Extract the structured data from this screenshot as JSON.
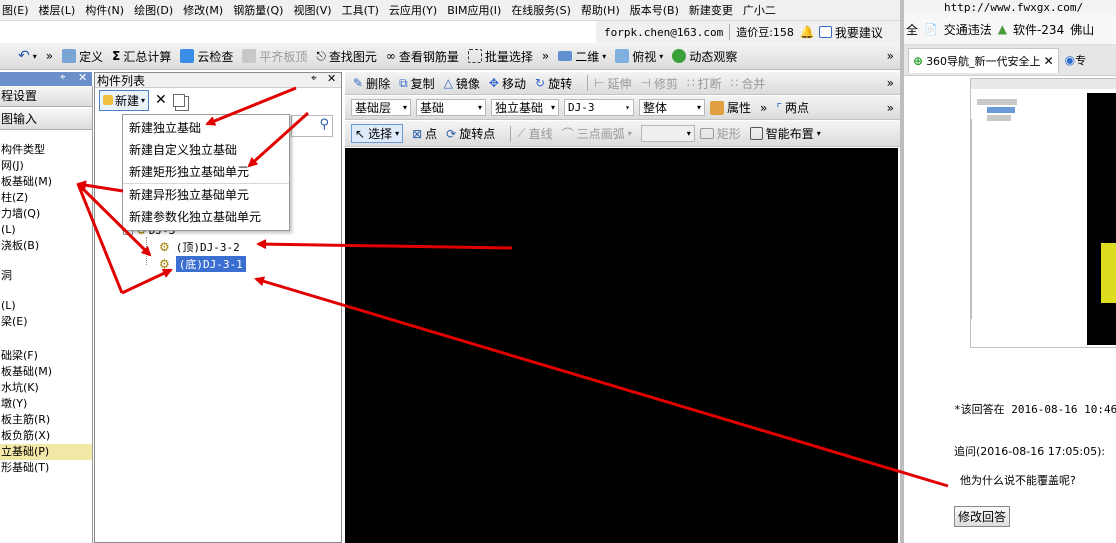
{
  "menubar": {
    "items": [
      "图(E)",
      "楼层(L)",
      "构件(N)",
      "绘图(D)",
      "修改(M)",
      "钢筋量(Q)",
      "视图(V)",
      "工具(T)",
      "云应用(Y)",
      "BIM应用(I)",
      "在线服务(S)",
      "帮助(H)",
      "版本号(B)",
      "新建变更",
      "广小二"
    ],
    "user_email": "forpk.chen@163.com",
    "price_beans": "造价豆:158",
    "suggest": "我要建议"
  },
  "toolbar1": {
    "define": "定义",
    "summary": "汇总计算",
    "cloud_check": "云检查",
    "flat_board": "平齐板顶",
    "find_element": "查找图元",
    "view_rebar": "查看钢筋量",
    "batch_select": "批量选择",
    "view_2d": "二维",
    "view_top": "俯视",
    "dynamic_view": "动态观察"
  },
  "left_panel": {
    "items": [
      {
        "text": "程设置",
        "style": "button"
      },
      {
        "text": "图输入",
        "style": "button"
      },
      {
        "text": "构件类型",
        "style": "plain"
      },
      {
        "text": "网(J)",
        "style": "plain"
      },
      {
        "text": "板基础(M)",
        "style": "plain"
      },
      {
        "text": "柱(Z)",
        "style": "plain"
      },
      {
        "text": "力墙(Q)",
        "style": "plain"
      },
      {
        "text": "(L)",
        "style": "plain"
      },
      {
        "text": "浇板(B)",
        "style": "plain"
      },
      {
        "text": "洞",
        "style": "plain"
      },
      {
        "text": "(L)",
        "style": "plain"
      },
      {
        "text": "梁(E)",
        "style": "plain"
      },
      {
        "text": "础梁(F)",
        "style": "plain"
      },
      {
        "text": "板基础(M)",
        "style": "plain"
      },
      {
        "text": "水坑(K)",
        "style": "plain"
      },
      {
        "text": "墩(Y)",
        "style": "plain"
      },
      {
        "text": "板主筋(R)",
        "style": "plain"
      },
      {
        "text": "板负筋(X)",
        "style": "plain"
      },
      {
        "text": "立基础(P)",
        "style": "selected"
      },
      {
        "text": "形基础(T)",
        "style": "plain"
      }
    ]
  },
  "component_panel": {
    "title": "构件列表",
    "new_button": "新建",
    "dropdown": [
      "新建独立基础",
      "新建自定义独立基础",
      "新建矩形独立基础单元",
      "新建异形独立基础单元",
      "新建参数化独立基础单元"
    ],
    "tree": {
      "root": "DJ-3",
      "children": [
        "(顶)DJ-3-2",
        "(底)DJ-3-1"
      ]
    }
  },
  "toolbar2": {
    "delete": "删除",
    "copy": "复制",
    "mirror": "镜像",
    "move": "移动",
    "rotate": "旋转",
    "extend": "延伸",
    "trim": "修剪",
    "break": "打断",
    "merge": "合并"
  },
  "toolbar3": {
    "layer": "基础层",
    "category": "基础",
    "type": "独立基础",
    "name": "DJ-3",
    "scope": "整体",
    "property": "属性",
    "two_points": "两点"
  },
  "toolbar4": {
    "select": "选择",
    "point": "点",
    "rotate_point": "旋转点",
    "line": "直线",
    "arc": "三点画弧",
    "rect": "矩形",
    "smart_layout": "智能布置"
  },
  "browser": {
    "url": "http://www.fwxgx.com/",
    "bookmarks": [
      "全",
      "交通违法",
      "软件-234",
      "佛山"
    ],
    "tab_active": "360导航_新一代安全上",
    "tab_other": "专",
    "answer_time": "*该回答在 2016-08-16 10:46:",
    "followup": "追问(2016-08-16 17:05:05):",
    "question": "他为什么说不能覆盖呢?",
    "edit_button": "修改回答"
  },
  "colors": {
    "accent": "#3366cc",
    "arrow": "#e00000",
    "canvas": "#000000"
  }
}
